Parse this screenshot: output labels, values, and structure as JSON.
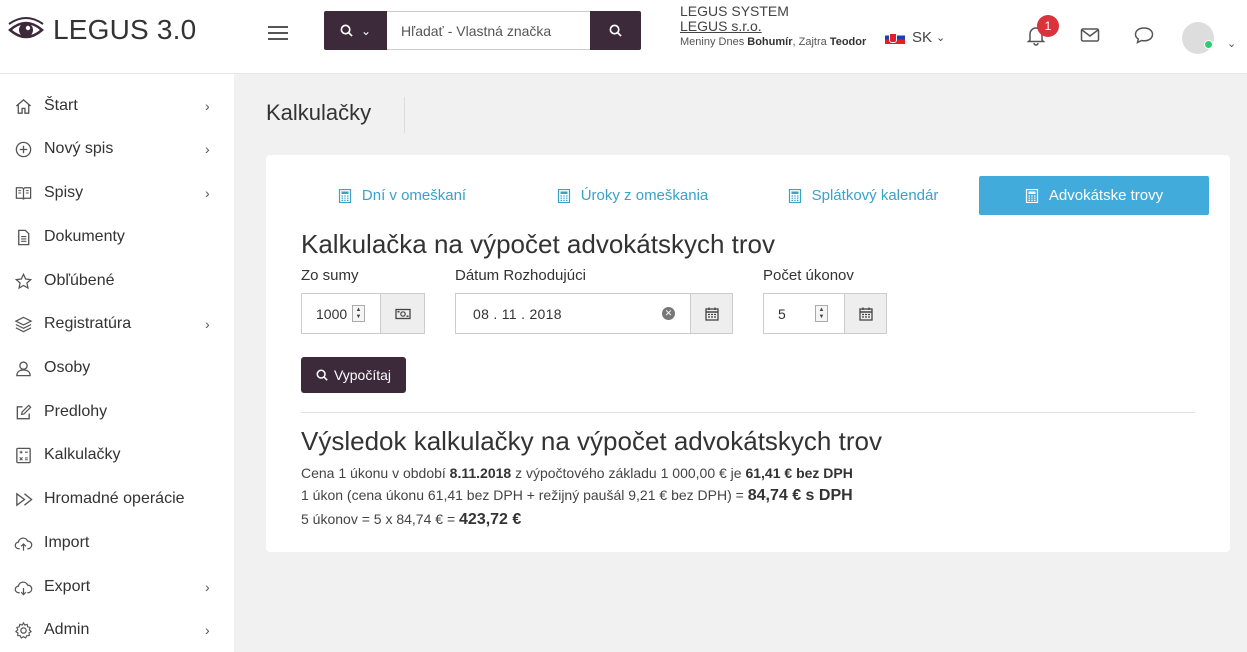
{
  "header": {
    "app_title": "LEGUS 3.0",
    "search_placeholder": "Hľadať - Vlastná značka",
    "org_line1": "LEGUS SYSTEM",
    "org_line2": "LEGUS s.r.o.",
    "nameday_prefix": "Meniny Dnes ",
    "nameday_today": "Bohumír",
    "nameday_mid": ", Zajtra ",
    "nameday_tomorrow": "Teodor",
    "language": "SK",
    "notification_count": "1"
  },
  "sidebar": {
    "items": [
      {
        "label": "Štart",
        "icon": "home-icon",
        "chevron": "›"
      },
      {
        "label": "Nový spis",
        "icon": "plus-circle-icon",
        "chevron": "›"
      },
      {
        "label": "Spisy",
        "icon": "book-icon",
        "chevron": "›"
      },
      {
        "label": "Dokumenty",
        "icon": "document-icon"
      },
      {
        "label": "Obľúbené",
        "icon": "star-icon"
      },
      {
        "label": "Registratúra",
        "icon": "layers-icon",
        "chevron": "›"
      },
      {
        "label": "Osoby",
        "icon": "user-icon"
      },
      {
        "label": "Predlohy",
        "icon": "edit-icon"
      },
      {
        "label": "Kalkulačky",
        "icon": "calculator-icon"
      },
      {
        "label": "Hromadné operácie",
        "icon": "bulk-icon"
      },
      {
        "label": "Import",
        "icon": "cloud-upload-icon"
      },
      {
        "label": "Export",
        "icon": "cloud-download-icon",
        "chevron": "›"
      },
      {
        "label": "Admin",
        "icon": "gear-icon",
        "chevron": "›"
      }
    ]
  },
  "page": {
    "title": "Kalkulačky"
  },
  "tabs": [
    {
      "label": "Dní v omeškaní"
    },
    {
      "label": "Úroky z omeškania"
    },
    {
      "label": "Splátkový kalendár"
    },
    {
      "label": "Advokátske trovy"
    }
  ],
  "form": {
    "heading": "Kalkulačka na výpočet advokátskych trov",
    "amount_label": "Zo sumy",
    "amount_value": "1000",
    "date_label": "Dátum Rozhodujúci",
    "date_value": "08 . 11 . 2018",
    "acts_label": "Počet úkonov",
    "acts_value": "5",
    "calculate_label": "Vypočítaj"
  },
  "result": {
    "heading": "Výsledok kalkulačky na výpočet advokátskych trov",
    "line1_a": "Cena 1 úkonu v období ",
    "line1_date": "8.11.2018",
    "line1_b": " z výpočtového základu 1 000,00 € je ",
    "line1_price": "61,41 € bez DPH",
    "line2_a": "1 úkon (cena úkonu 61,41 bez DPH + režijný paušál 9,21 € bez DPH) = ",
    "line2_total": "84,74 € s DPH",
    "line3_a": "5 úkonov = 5 x 84,74 € = ",
    "line3_total": "423,72 €"
  }
}
